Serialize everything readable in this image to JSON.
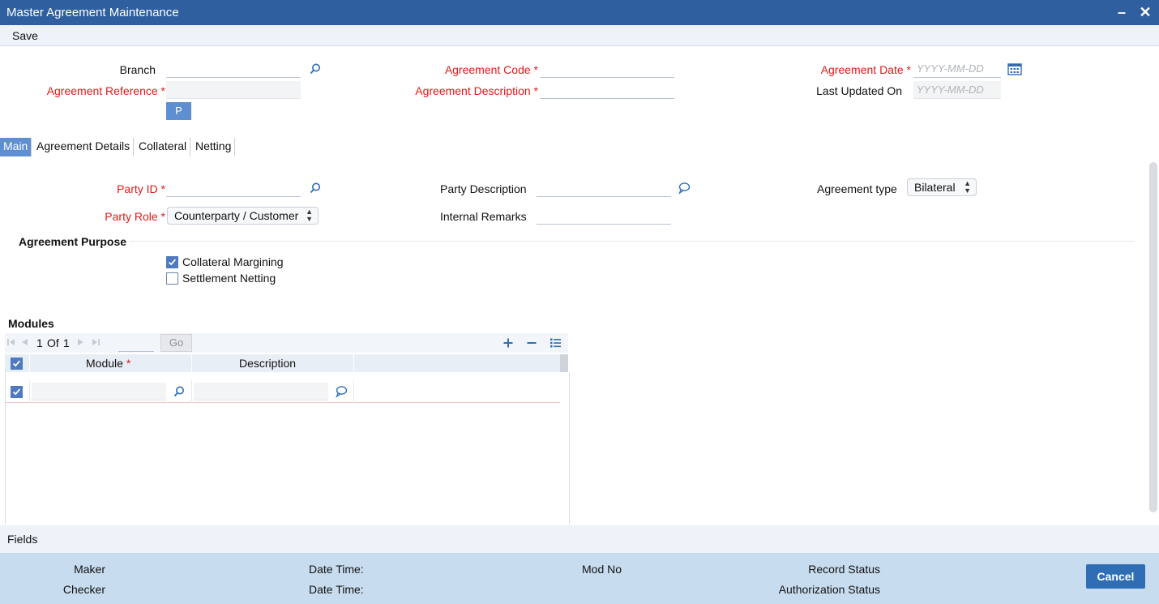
{
  "window": {
    "title": "Master Agreement Maintenance",
    "minimize": "–",
    "close": "✕"
  },
  "toolbar": {
    "save_label": "Save"
  },
  "header": {
    "branch_label": "Branch",
    "agreement_reference_label": "Agreement Reference",
    "agreement_code_label": "Agreement Code",
    "agreement_description_label": "Agreement Description",
    "agreement_date_label": "Agreement Date",
    "agreement_date_placeholder": "YYYY-MM-DD",
    "last_updated_label": "Last Updated On",
    "last_updated_placeholder": "YYYY-MM-DD",
    "p_button": "P",
    "required_mark": "*"
  },
  "tabs": [
    {
      "label": "Main",
      "active": true
    },
    {
      "label": "Agreement Details"
    },
    {
      "label": "Collateral"
    },
    {
      "label": "Netting"
    }
  ],
  "main": {
    "party_id_label": "Party ID",
    "party_role_label": "Party Role",
    "party_role_value": "Counterparty / Customer",
    "party_description_label": "Party Description",
    "internal_remarks_label": "Internal Remarks",
    "agreement_type_label": "Agreement type",
    "agreement_type_value": "Bilateral"
  },
  "purpose": {
    "title": "Agreement Purpose",
    "options": [
      {
        "label": "Collateral Margining",
        "checked": true
      },
      {
        "label": "Settlement Netting",
        "checked": false
      }
    ]
  },
  "modules": {
    "title": "Modules",
    "page_current": "1",
    "page_of": "Of",
    "page_total": "1",
    "go_label": "Go",
    "columns": [
      "Module",
      "Description"
    ],
    "module_required": "*"
  },
  "fields_label": "Fields",
  "footer": {
    "maker": "Maker",
    "checker": "Checker",
    "date_time_1": "Date Time:",
    "date_time_2": "Date Time:",
    "mod_no": "Mod No",
    "record_status": "Record Status",
    "authorization_status": "Authorization Status",
    "cancel": "Cancel"
  },
  "colors": {
    "title_bar": "#2f5f9e",
    "accent": "#5f8fd3",
    "required": "#e01818",
    "footer": "#c7dcef"
  }
}
